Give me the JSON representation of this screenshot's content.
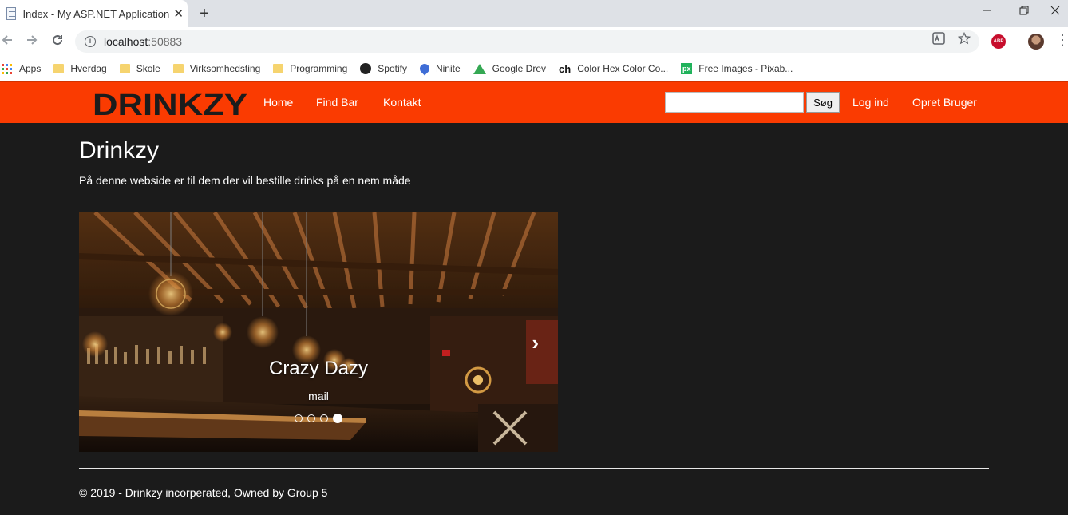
{
  "browser": {
    "tab_title": "Index - My ASP.NET Application",
    "close_glyph": "✕",
    "newtab_glyph": "+",
    "url_host": "localhost",
    "url_port": ":50883",
    "abp_label": "ABP"
  },
  "bookmarks": [
    {
      "label": "Apps",
      "icon": "apps-icon"
    },
    {
      "label": "Hverdag",
      "icon": "folder-icon"
    },
    {
      "label": "Skole",
      "icon": "folder-icon"
    },
    {
      "label": "Virksomhedsting",
      "icon": "folder-icon"
    },
    {
      "label": "Programming",
      "icon": "folder-icon"
    },
    {
      "label": "Spotify",
      "icon": "spotify-icon"
    },
    {
      "label": "Ninite",
      "icon": "ninite-icon"
    },
    {
      "label": "Google Drev",
      "icon": "google-drive-icon"
    },
    {
      "label": "Color Hex Color Co...",
      "icon": "ch-icon"
    },
    {
      "label": "Free Images - Pixab...",
      "icon": "pixabay-icon"
    }
  ],
  "site": {
    "logo": "DRINKZY",
    "nav": {
      "home": "Home",
      "find_bar": "Find Bar",
      "kontakt": "Kontakt",
      "search_button": "Søg",
      "login": "Log ind",
      "register": "Opret Bruger"
    },
    "colors": {
      "navbar": "#fa3b01",
      "background": "#1b1b1b"
    }
  },
  "main": {
    "title": "Drinkzy",
    "lead": "På denne webside er til dem der vil bestille drinks på en nem måde"
  },
  "carousel": {
    "caption_title": "Crazy Dazy",
    "caption_sub": "mail",
    "slide_count": 4,
    "active_index": 3
  },
  "footer": {
    "text": "© 2019 - Drinkzy incorperated, Owned by Group 5"
  }
}
